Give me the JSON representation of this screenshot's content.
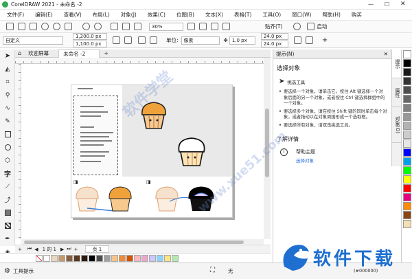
{
  "window": {
    "title": "CorelDRAW 2021 - 未命名 -2"
  },
  "menu": [
    "文件(F)",
    "编辑(E)",
    "查看(V)",
    "布局(L)",
    "对象(J)",
    "效果(C)",
    "位图(B)",
    "文本(X)",
    "表格(T)",
    "工具(O)",
    "窗口(W)",
    "帮助(H)",
    "购买"
  ],
  "toolbar": {
    "zoom": "30%",
    "snap": "贴齐(T)",
    "launch": "启动"
  },
  "propertybar": {
    "preset": "自定义",
    "width": "1,200.0 px",
    "height": "1,100.0 px",
    "unit_label": "单位:",
    "unit": "像素",
    "nudge": "1.0 px",
    "dup_x": "24.0 px",
    "dup_y": "24.0 px"
  },
  "tabs": {
    "welcome": "欢迎屏幕",
    "doc": "未命名 -2"
  },
  "pages": {
    "counter": "1 的 1",
    "page_tab": "页 1"
  },
  "status": {
    "tool_hint": "工具提示",
    "fill_label": "无",
    "coords": "(#000000)"
  },
  "docker": {
    "header": "提示(N)",
    "section_title": "选择对象",
    "tool_name": "挑选工具",
    "bullets": [
      "要选择一个对象，请单击它。按住 Alt 键选择一个对象后面的另一个对象，或者按住 Ctrl 键选择群组中的一个对象。",
      "要选择多个对象，请在按住 Shift 键的同时单击每个对象，或者拖动以在对象周围形成一个选取框。",
      "要选择所有对象，请双击挑选工具。"
    ],
    "more_title": "了解详情",
    "help_title": "帮助主题",
    "help_link": "选择对象"
  },
  "vtabs": [
    "提示",
    "属性",
    "对象(O)"
  ],
  "watermark": {
    "text1": "软件学堂",
    "text2": "www.xue51.com",
    "brand": "软件下载"
  },
  "colors": {
    "right_palette": [
      "#ffffff",
      "#000000",
      "#1a1a1a",
      "#333333",
      "#4d4d4d",
      "#666666",
      "#808080",
      "#999999",
      "#b3b3b3",
      "#cccccc",
      "#e6e6e6",
      "#0000ff",
      "#00a0e9",
      "#00ff00",
      "#ffff00",
      "#ff0000",
      "#e4007f",
      "#ff8c00",
      "#8b4513",
      "#f5deb3"
    ],
    "bottom_palette": [
      "#ffffff",
      "#e9d5c0",
      "#c49a6c",
      "#8b5e3c",
      "#5a3a22",
      "#2b1b0e",
      "#000000",
      "#4d4d4d",
      "#a0a0a0",
      "#f4c48a",
      "#f08a3c",
      "#d35400",
      "#ffb6c1",
      "#e8a8c8",
      "#c9c9ff",
      "#8cd3ff",
      "#ffe680",
      "#b5e8b0"
    ]
  }
}
